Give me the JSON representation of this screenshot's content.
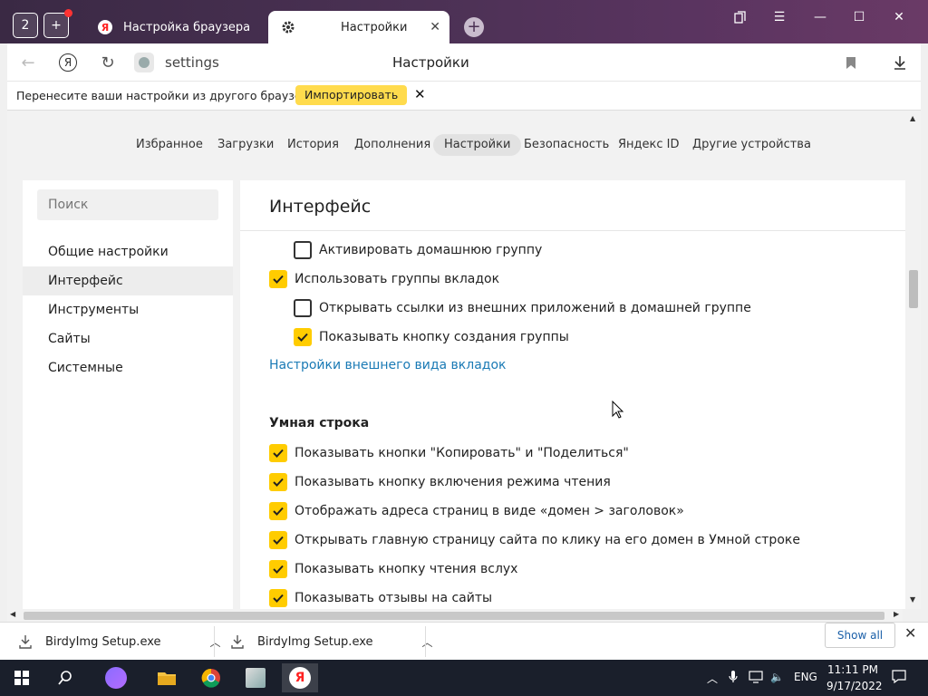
{
  "browser": {
    "profile_count": "2",
    "tabs": [
      {
        "label": "Настройка браузера",
        "active": false
      },
      {
        "label": "Настройки",
        "active": true
      }
    ],
    "address": {
      "url": "settings",
      "page_title": "Настройки"
    }
  },
  "banner": {
    "message": "Перенесите ваши настройки из другого браузера.",
    "import_label": "Импортировать",
    "close_glyph": "✕"
  },
  "topnav": [
    "Избранное",
    "Загрузки",
    "История",
    "Дополнения",
    "Настройки",
    "Безопасность",
    "Яндекс ID",
    "Другие устройства"
  ],
  "sidebar": {
    "search_placeholder": "Поиск",
    "items": [
      "Общие настройки",
      "Интерфейс",
      "Инструменты",
      "Сайты",
      "Системные"
    ]
  },
  "content": {
    "title": "Интерфейс",
    "options": [
      {
        "label": "Активировать домашнюю группу",
        "checked": false
      },
      {
        "label": "Использовать группы вкладок",
        "checked": true
      },
      {
        "label": "Открывать ссылки из внешних приложений в домашней группе",
        "checked": false
      },
      {
        "label": "Показывать кнопку создания группы",
        "checked": true
      }
    ],
    "tab_appearance_link": "Настройки внешнего вида вкладок",
    "smartbar_heading": "Умная строка",
    "smartbar_options": [
      {
        "label": "Показывать кнопки \"Копировать\" и \"Поделиться\"",
        "checked": true
      },
      {
        "label": "Показывать кнопку включения режима чтения",
        "checked": true
      },
      {
        "label": "Отображать адреса страниц в виде «домен > заголовок»",
        "checked": true
      },
      {
        "label": "Открывать главную страницу сайта по клику на его домен в Умной строке",
        "checked": true
      },
      {
        "label": "Показывать кнопку чтения вслух",
        "checked": true
      },
      {
        "label": "Показывать отзывы на сайты",
        "checked": true
      }
    ]
  },
  "downloads": {
    "items": [
      "BirdyImg Setup.exe",
      "BirdyImg Setup.exe"
    ],
    "show_all": "Show all"
  },
  "taskbar": {
    "lang": "ENG",
    "time": "11:11 PM",
    "date": "9/17/2022"
  },
  "colors": {
    "accent": "#ffcc00",
    "link": "#1a7ab5",
    "titlebar": "#4b3154"
  }
}
